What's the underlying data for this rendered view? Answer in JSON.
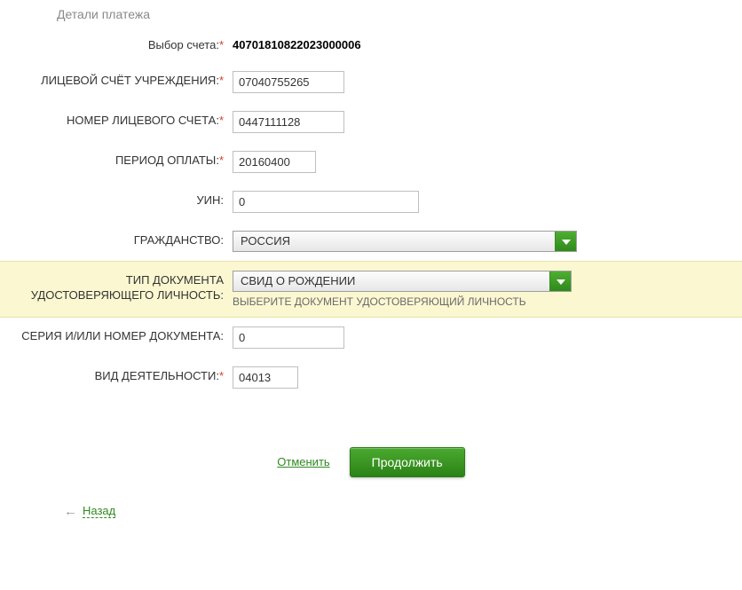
{
  "header": {
    "title": "Детали платежа"
  },
  "form": {
    "account_select": {
      "label": "Выбор счета:",
      "value": "40701810822023000006",
      "required": true
    },
    "institution_account": {
      "label": "ЛИЦЕВОЙ СЧЁТ УЧРЕЖДЕНИЯ:",
      "value": "07040755265",
      "required": true
    },
    "personal_account": {
      "label": "НОМЕР ЛИЦЕВОГО СЧЕТА:",
      "value": "0447111128",
      "required": true
    },
    "period": {
      "label": "ПЕРИОД ОПЛАТЫ:",
      "value": "20160400",
      "required": true
    },
    "uin": {
      "label": "УИН:",
      "value": "0",
      "required": false
    },
    "citizenship": {
      "label": "ГРАЖДАНСТВО:",
      "value": "РОССИЯ",
      "required": false
    },
    "doc_type": {
      "label": "ТИП ДОКУМЕНТА УДОСТОВЕРЯЮЩЕГО ЛИЧНОСТЬ:",
      "value": "СВИД О РОЖДЕНИИ",
      "hint": "ВЫБЕРИТЕ ДОКУМЕНТ УДОСТОВЕРЯЮЩИЙ ЛИЧНОСТЬ",
      "required": false
    },
    "doc_number": {
      "label": "СЕРИЯ И/ИЛИ НОМЕР ДОКУМЕНТА:",
      "value": "0",
      "required": false
    },
    "activity": {
      "label": "ВИД ДЕЯТЕЛЬНОСТИ:",
      "value": "04013",
      "required": true
    }
  },
  "actions": {
    "cancel": "Отменить",
    "continue": "Продолжить"
  },
  "nav": {
    "back": "Назад",
    "arrow": "←"
  }
}
